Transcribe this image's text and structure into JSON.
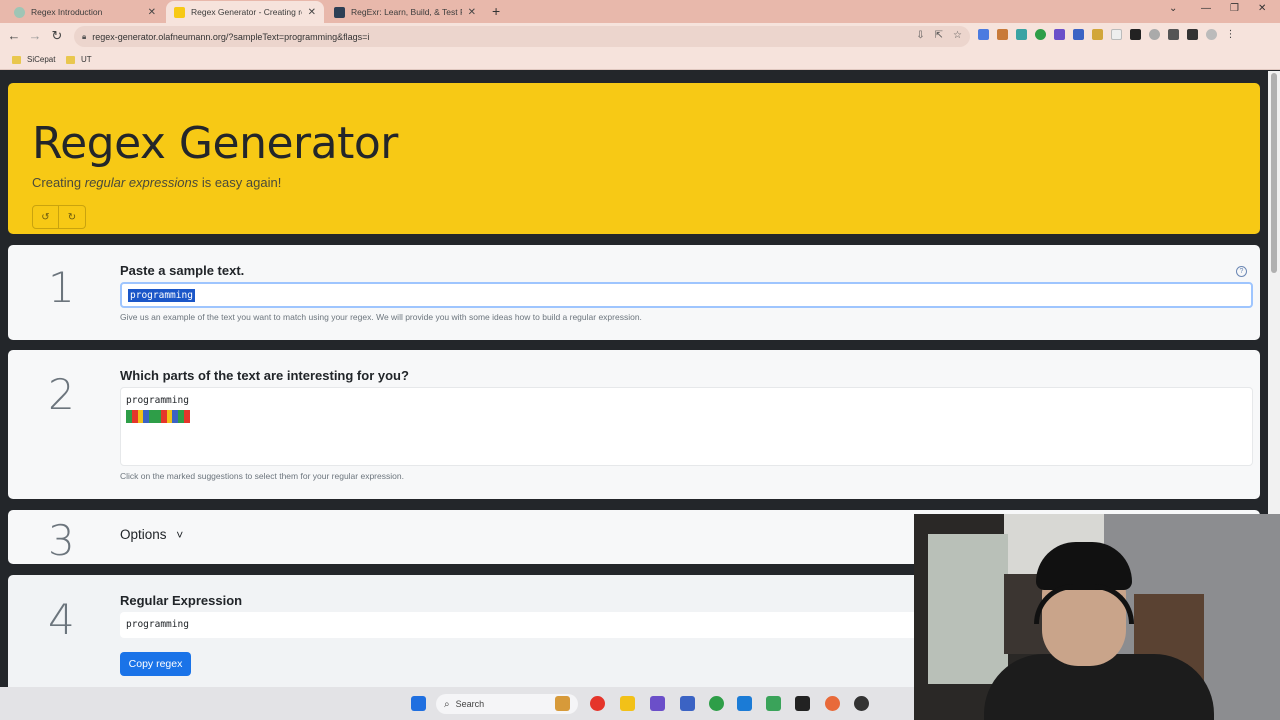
{
  "browser": {
    "tabs": [
      {
        "title": "Regex Introduction",
        "favicon_color": "#9fc5b5"
      },
      {
        "title": "Regex Generator - Creating regex",
        "favicon_color": "#f7c915"
      },
      {
        "title": "RegExr: Learn, Build, & Test RegEx",
        "favicon_color": "#2d3f55"
      }
    ],
    "new_tab": "+",
    "url": "regex-generator.olafneumann.org/?sampleText=programming&flags=i",
    "bookmarks": [
      "SiCepat",
      "UT"
    ]
  },
  "header": {
    "title": "Regex Generator",
    "lead_prefix": "Creating ",
    "lead_em": "regular expressions",
    "lead_suffix": " is easy again!",
    "icons": [
      "undo-icon",
      "redo-icon"
    ]
  },
  "step1": {
    "number": "1",
    "heading": "Paste a sample text.",
    "input_value": "programming",
    "help": "Give us an example of the text you want to match using your regex. We will provide you with some ideas how to build a regular expression."
  },
  "step2": {
    "number": "2",
    "heading": "Which parts of the text are interesting for you?",
    "sample": "programming",
    "help": "Click on the marked suggestions to select them for your regular expression.",
    "mark_colors": [
      "#2e9e48",
      "#e5352b",
      "#f2c118",
      "#3b63c4",
      "#2e9e48",
      "#2e9e48",
      "#e5352b",
      "#f2c118",
      "#3b63c4",
      "#2e9e48",
      "#e5352b"
    ]
  },
  "step3": {
    "number": "3",
    "heading": "Options",
    "chevron": "˅"
  },
  "step4": {
    "number": "4",
    "heading": "Regular Expression",
    "value": "programming",
    "copy_label": "Copy regex"
  },
  "taskbar": {
    "search_placeholder": "Search"
  },
  "colors": {
    "jumbotron": "#f7c915",
    "primary_button": "#1a73e8"
  }
}
